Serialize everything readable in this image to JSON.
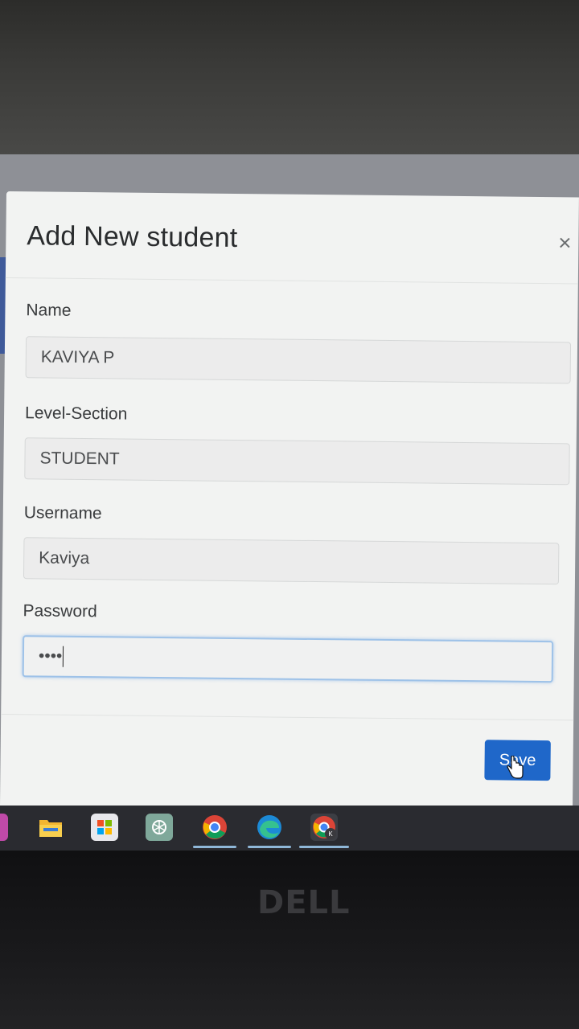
{
  "modal": {
    "title": "Add New student",
    "close_glyph": "×",
    "fields": [
      {
        "label": "Name",
        "value": "KAVIYA P"
      },
      {
        "label": "Level-Section",
        "value": "STUDENT"
      },
      {
        "label": "Username",
        "value": "Kaviya"
      },
      {
        "label": "Password",
        "value": "••••"
      }
    ],
    "save_label": "Save"
  },
  "taskbar": {
    "icons": [
      "file-explorer-icon",
      "store-icon",
      "chatgpt-icon",
      "chrome-icon",
      "edge-icon",
      "chrome-profile-icon"
    ]
  },
  "bezel": {
    "brand": "DELL"
  },
  "colors": {
    "accent": "#1f67c9",
    "focus_border": "#9ec2e8"
  }
}
